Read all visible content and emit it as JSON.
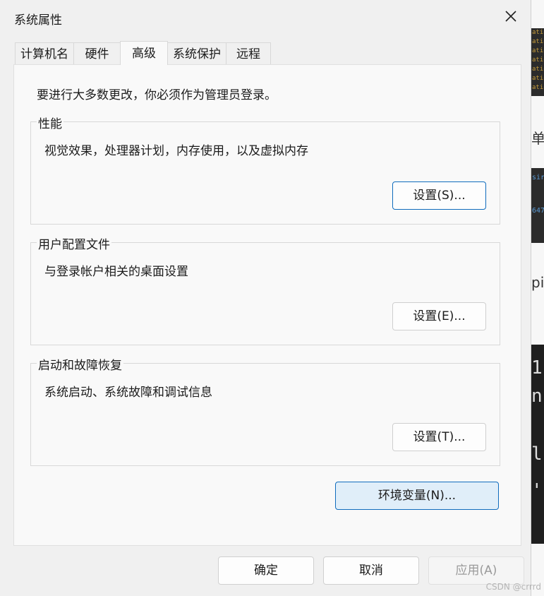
{
  "window": {
    "title": "系统属性"
  },
  "tabs": [
    {
      "label": "计算机名"
    },
    {
      "label": "硬件"
    },
    {
      "label": "高级",
      "active": true
    },
    {
      "label": "系统保护"
    },
    {
      "label": "远程"
    }
  ],
  "admin_note": "要进行大多数更改，你必须作为管理员登录。",
  "groups": [
    {
      "title": "性能",
      "description": "视觉效果，处理器计划，内存使用，以及虚拟内存",
      "button": "设置(S)..."
    },
    {
      "title": "用户配置文件",
      "description": "与登录帐户相关的桌面设置",
      "button": "设置(E)..."
    },
    {
      "title": "启动和故障恢复",
      "description": "系统启动、系统故障和调试信息",
      "button": "设置(T)..."
    }
  ],
  "env_button": "环境变量(N)...",
  "footer": {
    "ok": "确定",
    "cancel": "取消",
    "apply": "应用(A)"
  },
  "background": {
    "code_lines": [
      "ation",
      "ation",
      "ation",
      "ation",
      "ation",
      "ation",
      "ation"
    ],
    "text1": "单杉",
    "link1": "sir",
    "link2": "647",
    "text2": "pi",
    "term1": "1",
    "term2": "n",
    "term3": "l",
    "term4": "'"
  },
  "watermark": "CSDN @crrrd",
  "colors": {
    "accent": "#0f6cbd",
    "env_button_bg": "#e0eef9"
  }
}
